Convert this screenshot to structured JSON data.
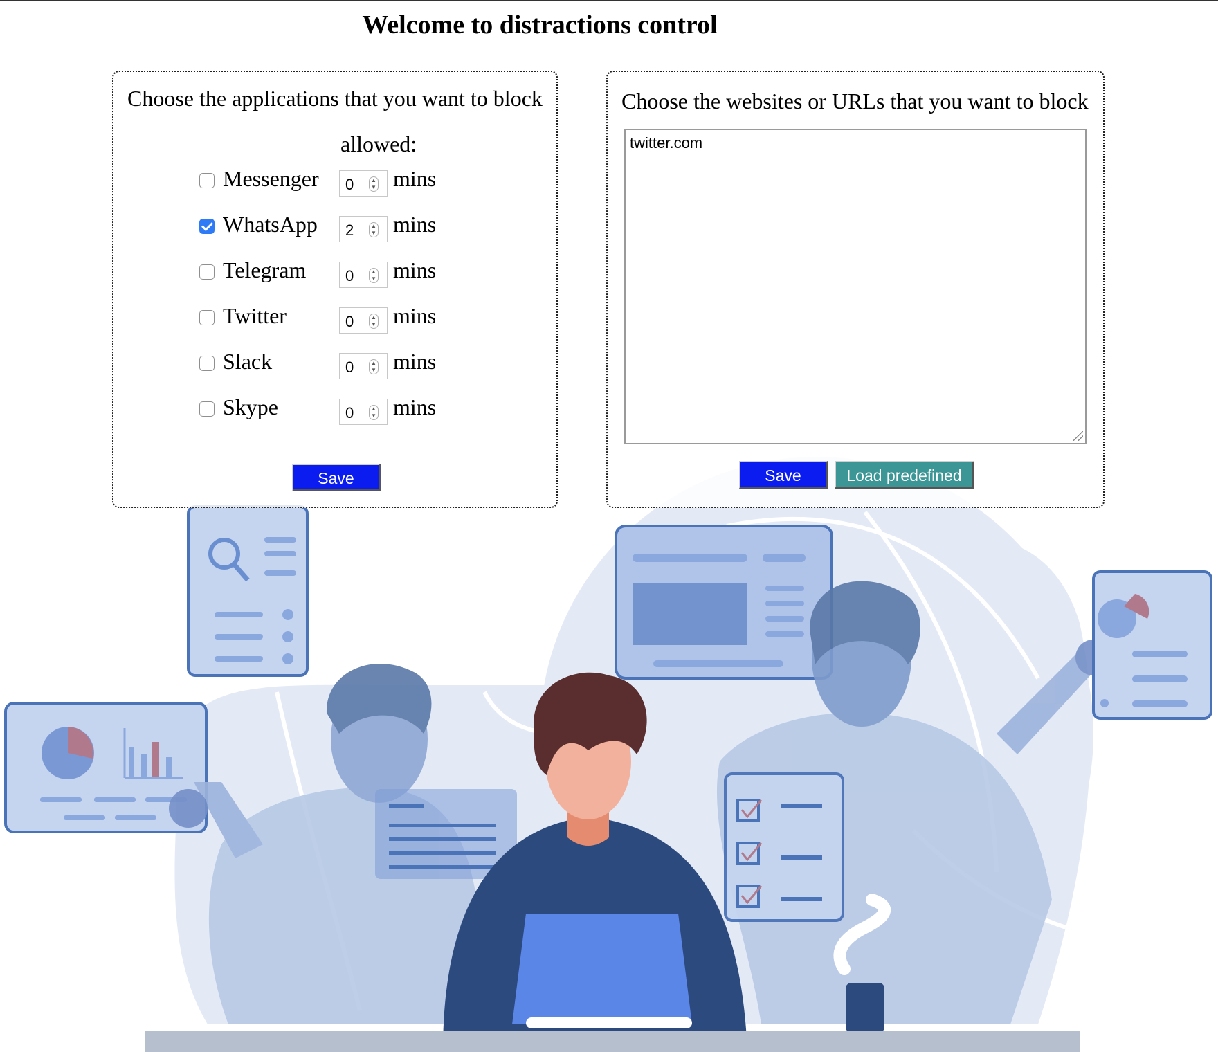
{
  "page": {
    "title": "Welcome to distractions control"
  },
  "apps_panel": {
    "title": "Choose the applications that you want to block",
    "allowed_header": "allowed:",
    "apps": [
      {
        "name": "Messenger",
        "checked": false,
        "minutes": "0",
        "unit": "mins"
      },
      {
        "name": "WhatsApp",
        "checked": true,
        "minutes": "2",
        "unit": "mins"
      },
      {
        "name": "Telegram",
        "checked": false,
        "minutes": "0",
        "unit": "mins"
      },
      {
        "name": "Twitter",
        "checked": false,
        "minutes": "0",
        "unit": "mins"
      },
      {
        "name": "Slack",
        "checked": false,
        "minutes": "0",
        "unit": "mins"
      },
      {
        "name": "Skype",
        "checked": false,
        "minutes": "0",
        "unit": "mins"
      }
    ],
    "save_label": "Save"
  },
  "sites_panel": {
    "title": "Choose the websites or URLs that you want to block",
    "textarea_value": "twitter.com",
    "save_label": "Save",
    "load_label": "Load predefined"
  },
  "colors": {
    "save_button": "#0a1cf0",
    "load_button": "#3d9696",
    "checkbox_checked": "#2f7bf5",
    "illustration_light": "#e3eaf6",
    "illustration_mid": "#b3c6e6",
    "illustration_dark": "#2c4a7e"
  },
  "icons": {
    "checkbox": "checkbox",
    "spinner": "up-down-spinner-icon",
    "resize": "resize-grip-icon"
  }
}
